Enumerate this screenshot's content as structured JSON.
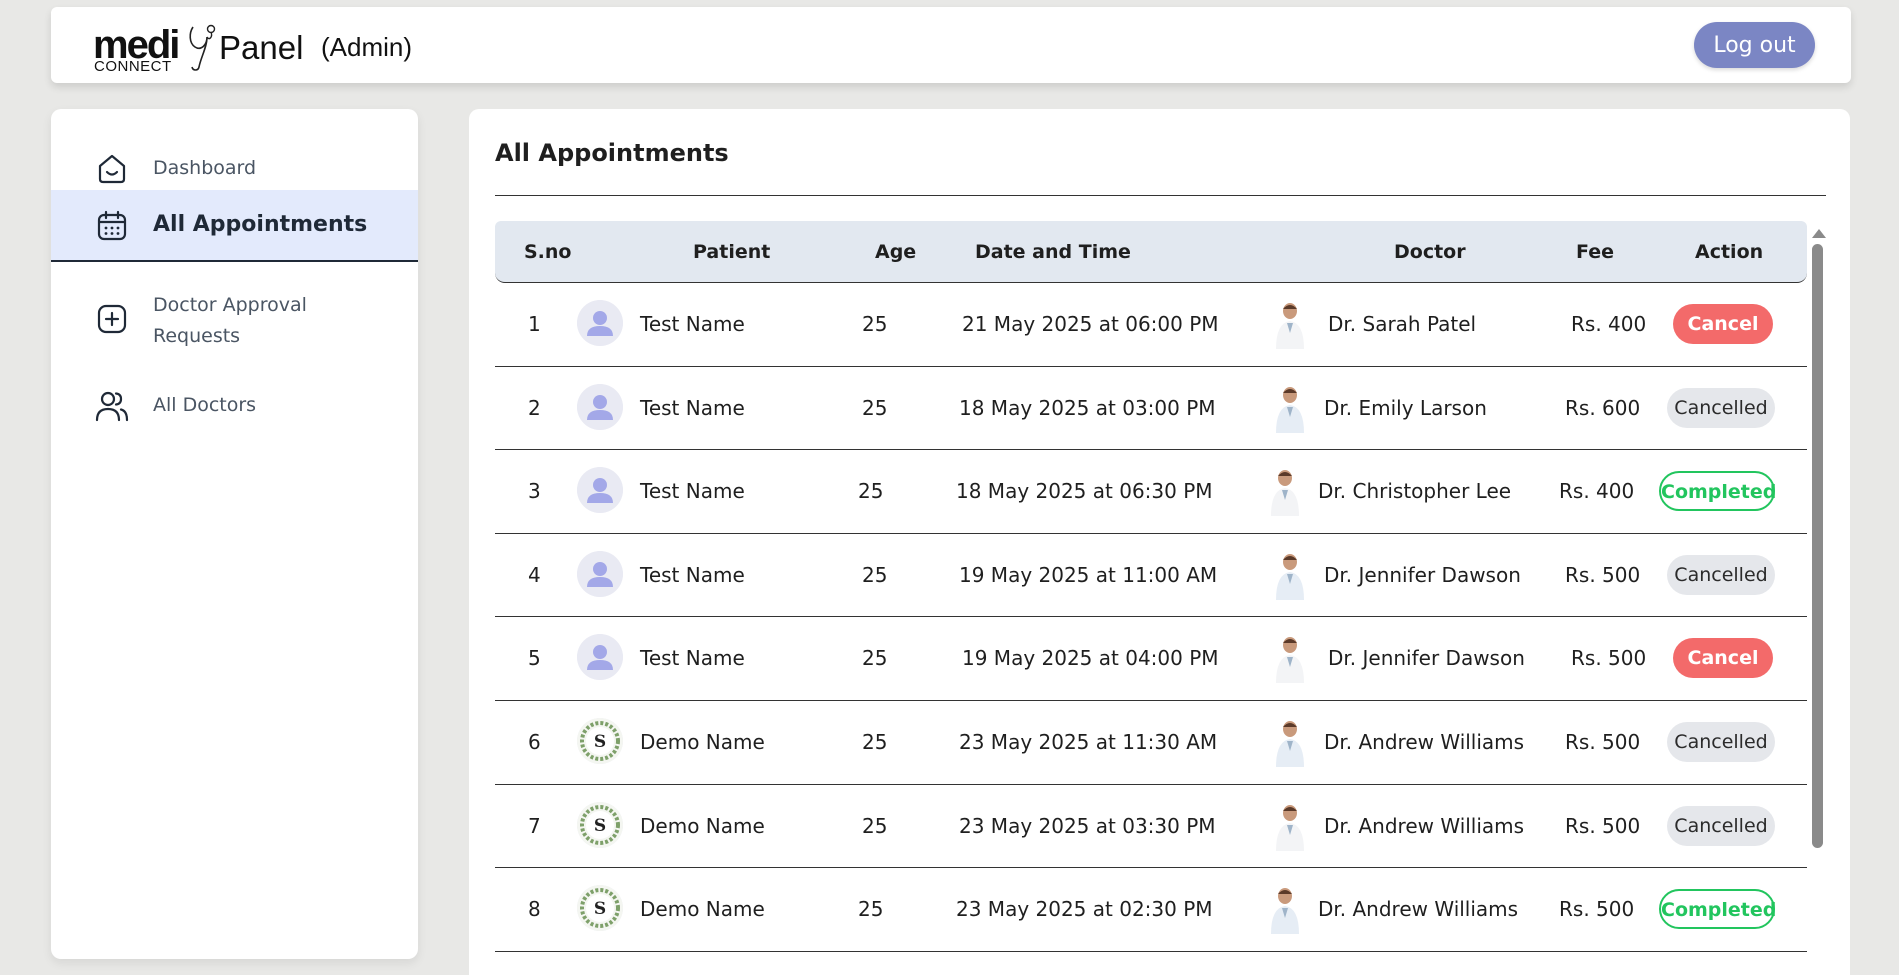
{
  "header": {
    "brand_main": "medi",
    "brand_sub": "CONNECT",
    "brand_panel": "Panel",
    "role": "(Admin)",
    "logout_label": "Log out"
  },
  "sidebar": {
    "items": [
      {
        "label": "Dashboard",
        "icon": "home-icon",
        "active": false
      },
      {
        "label": "All Appointments",
        "icon": "calendar-icon",
        "active": true
      },
      {
        "label": "Doctor Approval Requests",
        "icon": "add-square-icon",
        "active": false
      },
      {
        "label": "All Doctors",
        "icon": "users-icon",
        "active": false
      }
    ]
  },
  "main": {
    "title": "All Appointments",
    "columns": [
      "S.no",
      "Patient",
      "Age",
      "Date and Time",
      "Doctor",
      "Fee",
      "Action"
    ],
    "rows": [
      {
        "sno": "1",
        "patient": "Test Name",
        "avatar": "default-user",
        "age": "25",
        "datetime": "21 May 2025 at 06:00 PM",
        "doctor": "Dr. Sarah Patel",
        "fee": "Rs. 400",
        "action": "Cancel",
        "action_type": "cancel"
      },
      {
        "sno": "2",
        "patient": "Test Name",
        "avatar": "default-user",
        "age": "25",
        "datetime": "18 May 2025 at 03:00 PM",
        "doctor": "Dr. Emily Larson",
        "fee": "Rs. 600",
        "action": "Cancelled",
        "action_type": "cancelled"
      },
      {
        "sno": "3",
        "patient": "Test Name",
        "avatar": "default-user",
        "age": "25",
        "datetime": "18 May 2025 at 06:30 PM",
        "doctor": "Dr. Christopher Lee",
        "fee": "Rs. 400",
        "action": "Completed",
        "action_type": "completed"
      },
      {
        "sno": "4",
        "patient": "Test Name",
        "avatar": "default-user",
        "age": "25",
        "datetime": "19 May 2025 at 11:00 AM",
        "doctor": "Dr. Jennifer Dawson",
        "fee": "Rs. 500",
        "action": "Cancelled",
        "action_type": "cancelled"
      },
      {
        "sno": "5",
        "patient": "Test Name",
        "avatar": "default-user",
        "age": "25",
        "datetime": "19 May 2025 at 04:00 PM",
        "doctor": "Dr. Jennifer Dawson",
        "fee": "Rs. 500",
        "action": "Cancel",
        "action_type": "cancel"
      },
      {
        "sno": "6",
        "patient": "Demo Name",
        "avatar": "wreath-s",
        "age": "25",
        "datetime": "23 May 2025 at 11:30 AM",
        "doctor": "Dr. Andrew Williams",
        "fee": "Rs. 500",
        "action": "Cancelled",
        "action_type": "cancelled"
      },
      {
        "sno": "7",
        "patient": "Demo Name",
        "avatar": "wreath-s",
        "age": "25",
        "datetime": "23 May 2025 at 03:30 PM",
        "doctor": "Dr. Andrew Williams",
        "fee": "Rs. 500",
        "action": "Cancelled",
        "action_type": "cancelled"
      },
      {
        "sno": "8",
        "patient": "Demo Name",
        "avatar": "wreath-s",
        "age": "25",
        "datetime": "23 May 2025 at 02:30 PM",
        "doctor": "Dr. Andrew Williams",
        "fee": "Rs. 500",
        "action": "Completed",
        "action_type": "completed"
      }
    ]
  },
  "colors": {
    "accent": "#7b86c4",
    "active_nav_bg": "#e3eafc",
    "cancel": "#f36a6a",
    "completed": "#22c55e",
    "header_row_bg": "#e2e8f0"
  }
}
